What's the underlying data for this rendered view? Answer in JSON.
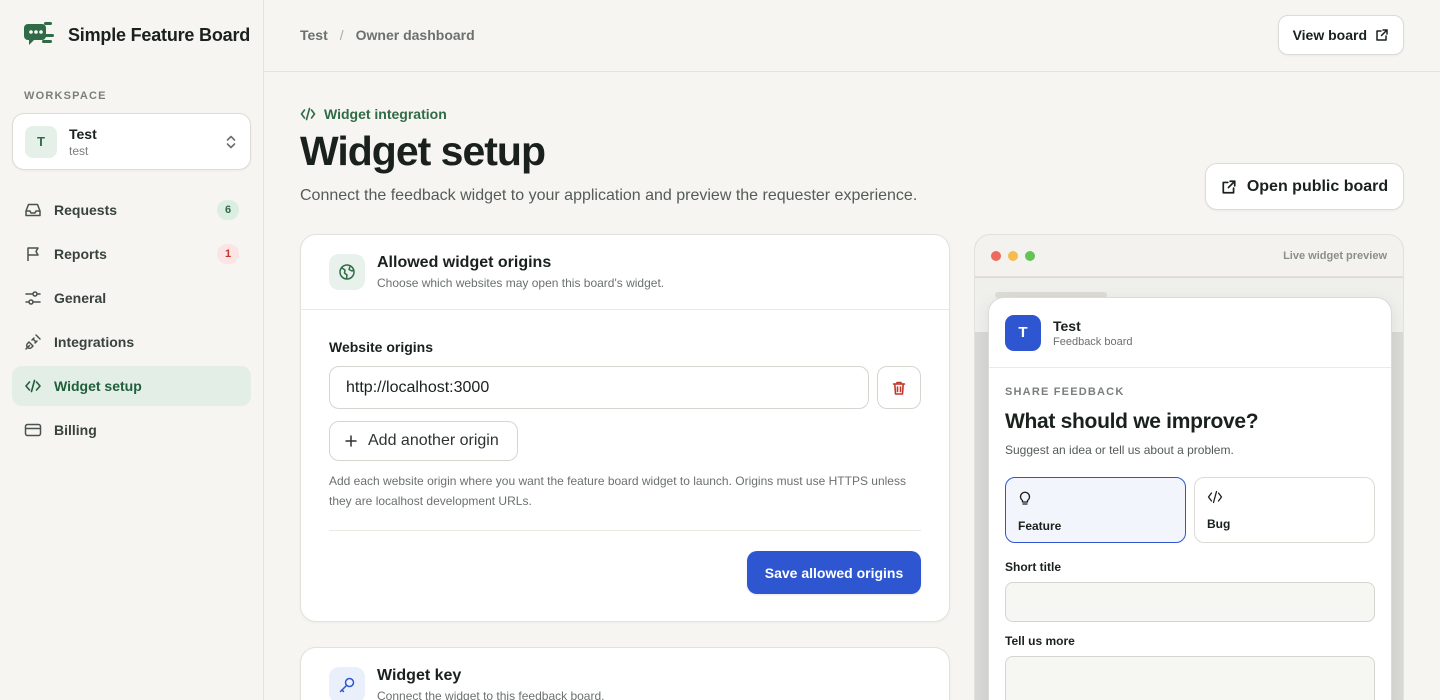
{
  "brand": {
    "name": "Simple Feature Board"
  },
  "workspace": {
    "section_label": "WORKSPACE",
    "avatar_letter": "T",
    "name": "Test",
    "slug": "test"
  },
  "nav": {
    "items": [
      {
        "label": "Requests",
        "icon": "inbox-icon",
        "badge": "6"
      },
      {
        "label": "Reports",
        "icon": "flag-icon",
        "badge": "1"
      },
      {
        "label": "General",
        "icon": "sliders-icon"
      },
      {
        "label": "Integrations",
        "icon": "plug-icon"
      },
      {
        "label": "Widget setup",
        "icon": "code-icon",
        "active": true
      },
      {
        "label": "Billing",
        "icon": "credit-card-icon"
      }
    ]
  },
  "header": {
    "breadcrumb": [
      "Test",
      "Owner dashboard"
    ],
    "separator": "/",
    "view_board_label": "View board"
  },
  "page": {
    "eyebrow": "Widget integration",
    "title": "Widget setup",
    "subtitle": "Connect the feedback widget to your application and preview the requester experience.",
    "open_public_board_label": "Open public board"
  },
  "origins_card": {
    "title": "Allowed widget origins",
    "description": "Choose which websites may open this board's widget.",
    "field_label": "Website origins",
    "origin_value": "http://localhost:3000",
    "add_label": "Add another origin",
    "help": "Add each website origin where you want the feature board widget to launch. Origins must use HTTPS unless they are localhost development URLs.",
    "save_label": "Save allowed origins"
  },
  "key_card": {
    "title": "Widget key",
    "description": "Connect the widget to this feedback board."
  },
  "preview": {
    "label": "Live widget preview",
    "dots": [
      "#ee6a5f",
      "#f5bd4f",
      "#61c454"
    ],
    "widget": {
      "avatar_letter": "T",
      "board_name": "Test",
      "board_sub": "Feedback board",
      "eyebrow": "SHARE FEEDBACK",
      "title": "What should we improve?",
      "description": "Suggest an idea or tell us about a problem.",
      "types": [
        {
          "label": "Feature",
          "icon": "lightbulb-icon",
          "selected": true
        },
        {
          "label": "Bug",
          "icon": "code-icon",
          "selected": false
        }
      ],
      "short_title_label": "Short title",
      "more_label": "Tell us more"
    }
  },
  "colors": {
    "accent": "#2f56d1",
    "brand_green": "#2f6b46"
  }
}
